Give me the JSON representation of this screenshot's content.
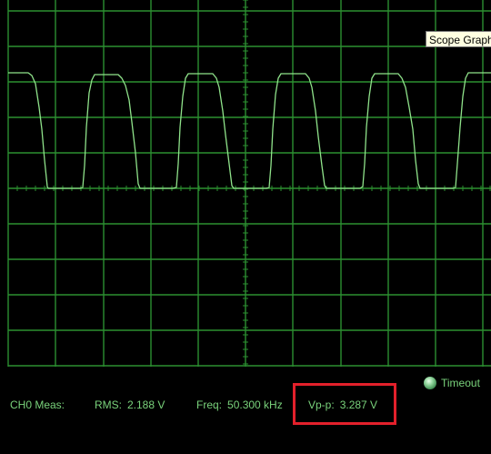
{
  "window": {
    "tooltip": "Scope Graph"
  },
  "measurements": {
    "channel_label": "CH0 Meas:",
    "rms_label": "RMS:",
    "rms_value": "2.188 V",
    "freq_label": "Freq:",
    "freq_value": "50.300 kHz",
    "vpp_label": "Vp-p:",
    "vpp_value": "3.287 V"
  },
  "status": {
    "timeout_label": "Timeout",
    "timeout_icon": "led-indicator-icon"
  },
  "colors": {
    "background": "#000000",
    "grid": "#2c8f31",
    "trace": "#8fe28a",
    "text": "#79d27b",
    "highlight": "#e3202b"
  }
}
